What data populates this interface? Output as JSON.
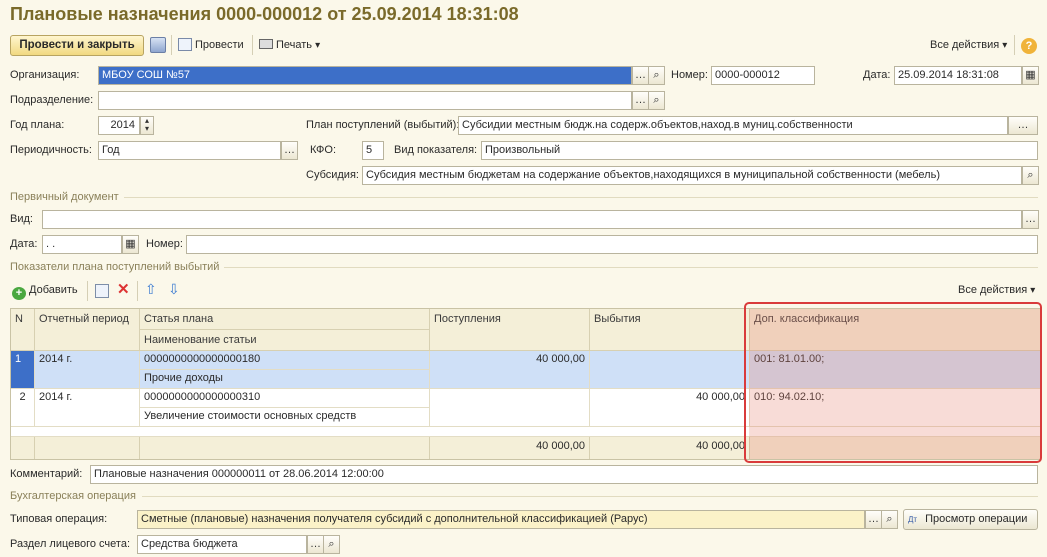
{
  "window": {
    "title": "Плановые назначения 0000-000012 от 25.09.2014 18:31:08"
  },
  "toolbar": {
    "post_close_label": "Провести и закрыть",
    "post_label": "Провести",
    "print_label": "Печать",
    "all_actions_label": "Все действия",
    "help_label": "?"
  },
  "form": {
    "org_label": "Организация:",
    "org_value": "МБОУ СОШ №57",
    "number_label": "Номер:",
    "number_value": "0000-000012",
    "date_label": "Дата:",
    "date_value": "25.09.2014 18:31:08",
    "dept_label": "Подразделение:",
    "dept_value": "",
    "year_label": "Год плана:",
    "year_value": "2014",
    "plan_label": "План поступлений (выбытий):",
    "plan_value": "Субсидии местным бюдж.на содерж.объектов,наход.в муниц.собственности",
    "period_label": "Периодичность:",
    "period_value": "Год",
    "kfo_label": "КФО:",
    "kfo_value": "5",
    "indicator_label": "Вид показателя:",
    "indicator_value": "Произвольный",
    "subsidy_label": "Субсидия:",
    "subsidy_value": "Субсидия местным бюджетам на содержание объектов,находящихся в муниципальной собственности (мебель)"
  },
  "primary_doc": {
    "section_label": "Первичный документ",
    "kind_label": "Вид:",
    "kind_value": "",
    "date_label": "Дата:",
    "date_value": " .  .",
    "number_label": "Номер:",
    "number_value": ""
  },
  "indicators": {
    "section_label": "Показатели плана поступлений выбытий",
    "add_label": "Добавить",
    "all_actions_label": "Все действия",
    "columns": {
      "n": "N",
      "period": "Отчетный период",
      "article": "Статья плана",
      "article_name": "Наименование статьи",
      "income": "Поступления",
      "outflow": "Выбытия",
      "extra": "Доп. классификация"
    },
    "rows": [
      {
        "n": "1",
        "period": "2014 г.",
        "article": "0000000000000000180",
        "article_name": "Прочие доходы",
        "income": "40 000,00",
        "outflow": "",
        "extra": "001: 81.01.00;"
      },
      {
        "n": "2",
        "period": "2014 г.",
        "article": "0000000000000000310",
        "article_name": "Увеличение стоимости основных средств",
        "income": "",
        "outflow": "40 000,00",
        "extra": "010: 94.02.10;"
      }
    ],
    "totals": {
      "income": "40 000,00",
      "outflow": "40 000,00"
    }
  },
  "comment": {
    "label": "Комментарий:",
    "value": "Плановые назначения 000000011 от 28.06.2014 12:00:00"
  },
  "accounting": {
    "section_label": "Бухгалтерская операция",
    "op_label": "Типовая операция:",
    "op_value": "Сметные (плановые) назначения получателя субсидий с дополнительной классификацией (Рарус)",
    "view_op_label": "Просмотр операции",
    "account_section_label": "Раздел лицевого счета:",
    "account_section_value": "Средства бюджета"
  },
  "colors": {
    "highlight": "#d93b3b",
    "selection": "#3d6fc8",
    "title": "#7a6a2a"
  }
}
